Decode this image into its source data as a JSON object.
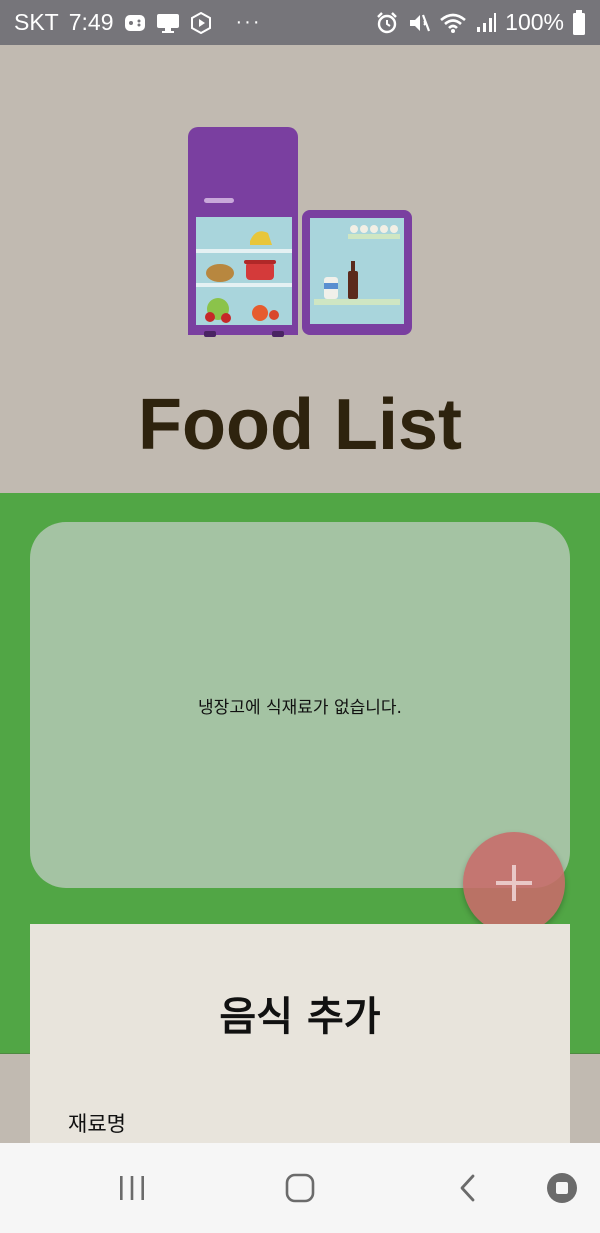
{
  "status_bar": {
    "carrier": "SKT",
    "time": "7:49",
    "more": "···",
    "battery": "100%",
    "icons": [
      "game-icon",
      "monitor-icon",
      "cast-icon",
      "alarm-icon",
      "mute-icon",
      "wifi-icon",
      "signal-icon",
      "battery-icon"
    ]
  },
  "header": {
    "title": "Food List",
    "illustration": "fridge-icon"
  },
  "food_list": {
    "empty_message": "냉장고에 식재료가 없습니다."
  },
  "fab": {
    "icon": "plus-icon"
  },
  "add_panel": {
    "title": "음식 추가",
    "name_label": "재료명"
  },
  "nav_bar": {
    "icons": [
      "recent-apps-icon",
      "home-icon",
      "back-icon",
      "stop-icon"
    ]
  },
  "colors": {
    "status_bar": "#76757a",
    "header_bg": "#c1bab1",
    "title": "#2e230e",
    "green": "#51a645",
    "card": "#a4c3a3",
    "fab": "#c86b6a",
    "panel": "#e8e4dc",
    "fridge": "#7a3fa0"
  }
}
